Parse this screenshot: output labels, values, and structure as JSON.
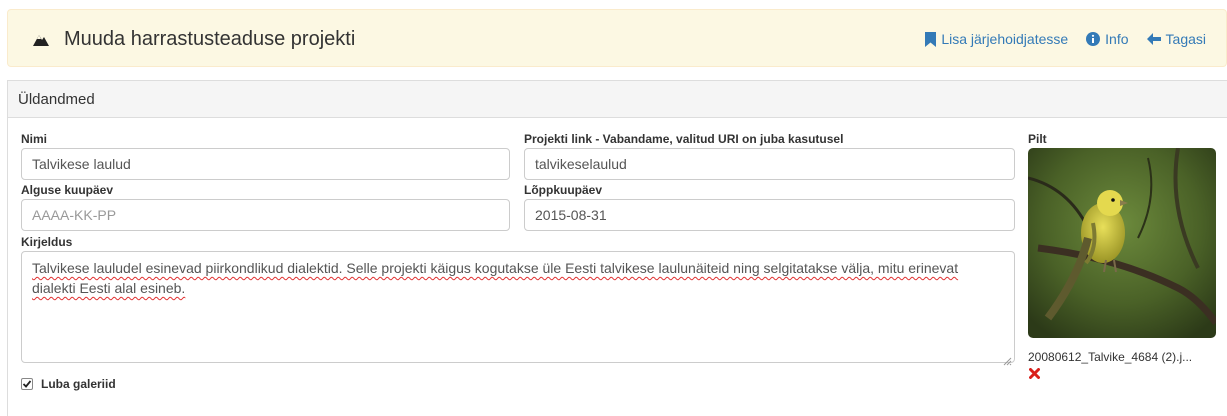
{
  "header": {
    "title": "Muuda harrastusteaduse projekti",
    "actions": [
      {
        "label": "Lisa järjehoidjatesse",
        "icon": "bookmark-icon"
      },
      {
        "label": "Info",
        "icon": "info-icon"
      },
      {
        "label": "Tagasi",
        "icon": "arrow-left-icon"
      }
    ]
  },
  "panel": {
    "heading": "Üldandmed",
    "fields": {
      "name": {
        "label": "Nimi",
        "value": "Talvikese laulud"
      },
      "link": {
        "label": "Projekti link - Vabandame, valitud URI on juba kasutusel",
        "value": "talvikeselaulud"
      },
      "start": {
        "label": "Alguse kuupäev",
        "value": "",
        "placeholder": "AAAA-KK-PP"
      },
      "end": {
        "label": "Lõppkuupäev",
        "value": "2015-08-31"
      },
      "description": {
        "label": "Kirjeldus",
        "value": "Talvikese lauludel esinevad piirkondlikud dialektid. Selle projekti käigus kogutakse üle Eesti talvikese laulunäiteid ning selgitatakse välja, mitu erinevat dialekti Eesti alal esineb."
      }
    },
    "picture": {
      "label": "Pilt",
      "filename": "20080612_Talvike_4684 (2).j..."
    },
    "gallery": {
      "label": "Luba galeriid",
      "checked": true
    }
  },
  "colors": {
    "link": "#337ab7",
    "header_bg": "#fcf8e3",
    "remove": "#d9201b"
  }
}
